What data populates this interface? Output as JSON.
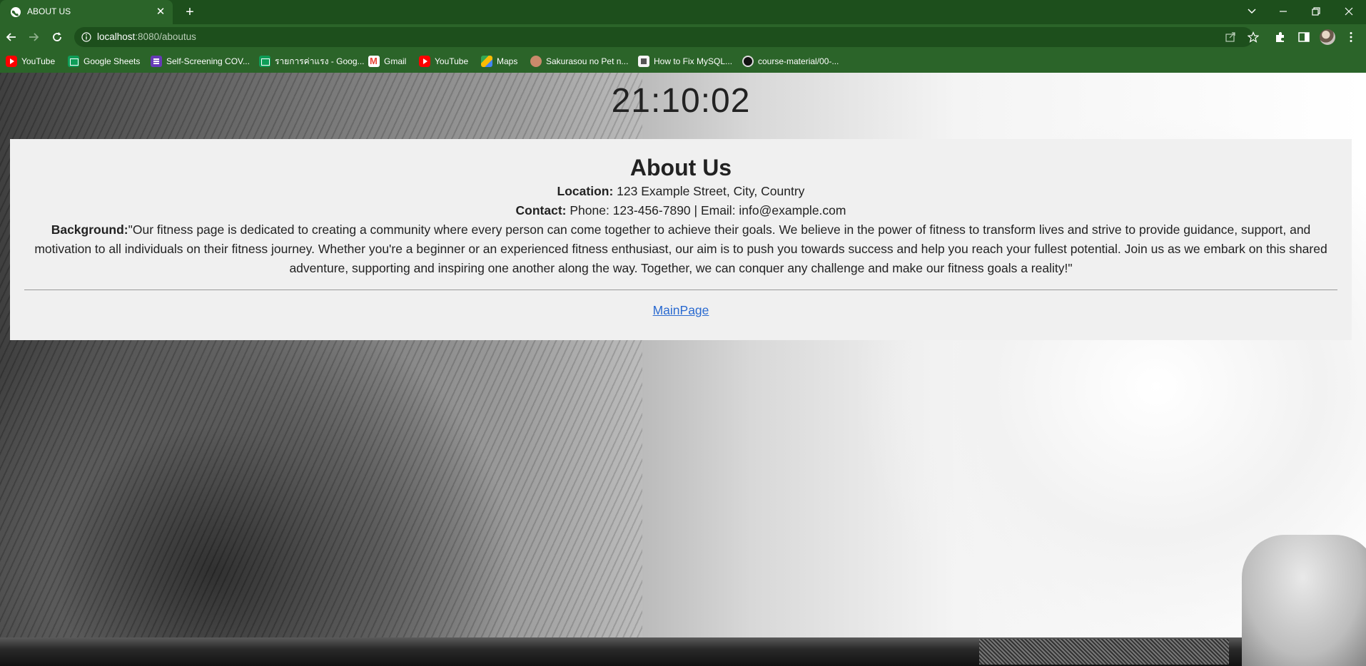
{
  "browser": {
    "tab": {
      "title": "ABOUT US"
    },
    "address": {
      "host": "localhost",
      "path": ":8080/aboutus"
    },
    "bookmarks": [
      {
        "label": "YouTube",
        "icon": "youtube-icon"
      },
      {
        "label": "Google Sheets",
        "icon": "google-sheets-icon"
      },
      {
        "label": "Self-Screening COV...",
        "icon": "google-forms-icon"
      },
      {
        "label": "รายการค่าแรง - Goog...",
        "icon": "google-sheets-icon"
      },
      {
        "label": "Gmail",
        "icon": "gmail-icon"
      },
      {
        "label": "YouTube",
        "icon": "youtube-icon"
      },
      {
        "label": "Maps",
        "icon": "maps-icon"
      },
      {
        "label": "Sakurasou no Pet n...",
        "icon": "sakurasou-icon"
      },
      {
        "label": "How to Fix MySQL...",
        "icon": "page-icon"
      },
      {
        "label": "course-material/00-...",
        "icon": "github-icon"
      }
    ],
    "colors": {
      "chrome": "#2b6429",
      "tabstrip": "#1d4f1c"
    }
  },
  "page": {
    "clock": "21:10:02",
    "about": {
      "title": "About Us",
      "location_label": "Location:",
      "location_value": "123 Example Street, City, Country",
      "contact_label": "Contact:",
      "contact_value": "Phone: 123-456-7890 | Email: info@example.com",
      "background_label": "Background:",
      "background_value": "\"Our fitness page is dedicated to creating a community where every person can come together to achieve their goals. We believe in the power of fitness to transform lives and strive to provide guidance, support, and motivation to all individuals on their fitness journey. Whether you're a beginner or an experienced fitness enthusiast, our aim is to push you towards success and help you reach your fullest potential. Join us as we embark on this shared adventure, supporting and inspiring one another along the way. Together, we can conquer any challenge and make our fitness goals a reality!\"",
      "link": "MainPage"
    }
  }
}
